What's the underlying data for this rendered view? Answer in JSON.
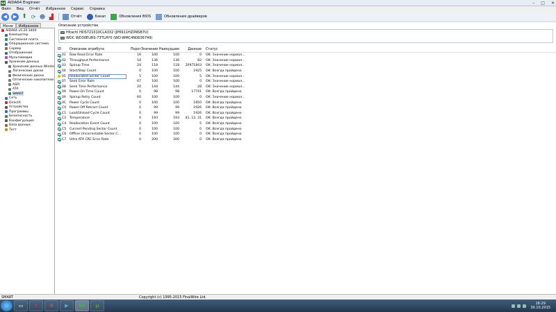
{
  "window": {
    "title": "AIDA64 Engineer",
    "controls": [
      "–",
      "□",
      "✕"
    ]
  },
  "menu": [
    "Файл",
    "Вид",
    "Отчёт",
    "Избранное",
    "Сервис",
    "Справка"
  ],
  "toolbar": {
    "report": "Отчёт",
    "bios_label": "Бэкап",
    "bios_update": "Обновления BIOS",
    "driver_update": "Обновления драйверов"
  },
  "left_tabs": [
    "Меню",
    "Избранное"
  ],
  "tree": [
    {
      "label": "AIDA64 v5.20.3400",
      "level": 0,
      "color": "#c03030"
    },
    {
      "label": "Компьютер",
      "level": 1,
      "color": "#3a6ba8"
    },
    {
      "label": "Системная плата",
      "level": 1,
      "color": "#2e8b57"
    },
    {
      "label": "Операционная система",
      "level": 1,
      "color": "#3a6ba8"
    },
    {
      "label": "Сервер",
      "level": 1,
      "color": "#8a6d3b"
    },
    {
      "label": "Отображение",
      "level": 1,
      "color": "#3a6ba8"
    },
    {
      "label": "Мультимедиа",
      "level": 1,
      "color": "#b0508a"
    },
    {
      "label": "Хранение данных",
      "level": 1,
      "color": "#555555"
    },
    {
      "label": "Хранение данных Windows",
      "level": 2,
      "color": "#777777"
    },
    {
      "label": "Логические диски",
      "level": 2,
      "color": "#777777"
    },
    {
      "label": "Физические диски",
      "level": 2,
      "color": "#777777"
    },
    {
      "label": "Оптические накопители",
      "level": 2,
      "color": "#777777"
    },
    {
      "label": "ASPI",
      "level": 2,
      "color": "#777777"
    },
    {
      "label": "ATA",
      "level": 2,
      "color": "#777777"
    },
    {
      "label": "SMART",
      "level": 2,
      "color": "#2e8b57",
      "selected": true
    },
    {
      "label": "Сеть",
      "level": 1,
      "color": "#3a6ba8"
    },
    {
      "label": "DirectX",
      "level": 1,
      "color": "#c03030"
    },
    {
      "label": "Устройства",
      "level": 1,
      "color": "#555555"
    },
    {
      "label": "Программы",
      "level": 1,
      "color": "#3a6ba8"
    },
    {
      "label": "Безопасность",
      "level": 1,
      "color": "#2e8b57"
    },
    {
      "label": "Конфигурация",
      "level": 1,
      "color": "#555555"
    },
    {
      "label": "База данных",
      "level": 1,
      "color": "#8a6d3b"
    },
    {
      "label": "Тест",
      "level": 1,
      "color": "#d08a20"
    }
  ],
  "device_section_title": "Описание устройства",
  "devices": [
    "Hitachi HDS721010CLA332 (JP6911HZ0NSB7U)",
    "WDC WD30EURS-73TLHY0 (WD-WMC4N0636749)"
  ],
  "smart_headers": {
    "id": "ID",
    "name": "Описание атрибута",
    "threshold": "Порог",
    "value": "Значение",
    "worst": "Наихудшее",
    "data": "Данные",
    "status": "Статус"
  },
  "smart_rows": [
    {
      "id": "01",
      "name": "Raw Read Error Rate",
      "threshold": "16",
      "value": "100",
      "worst": "100",
      "data": "0",
      "status": "OK: Значение нормал..."
    },
    {
      "id": "02",
      "name": "Throughput Performance",
      "threshold": "54",
      "value": "136",
      "worst": "136",
      "data": "82",
      "status": "OK: Значение нормал..."
    },
    {
      "id": "03",
      "name": "Spinup Time",
      "threshold": "24",
      "value": "118",
      "worst": "118",
      "data": "20971843",
      "status": "OK: Значение нормал..."
    },
    {
      "id": "04",
      "name": "Start/Stop Count",
      "threshold": "0",
      "value": "100",
      "worst": "100",
      "data": "1925",
      "status": "OK: Всегда пройдено"
    },
    {
      "id": "05",
      "name": "Reallocated Sector Count",
      "threshold": "5",
      "value": "100",
      "worst": "100",
      "data": "5",
      "status": "OK: Значение нормал...",
      "warn": true
    },
    {
      "id": "07",
      "name": "Seek Error Rate",
      "threshold": "67",
      "value": "100",
      "worst": "100",
      "data": "0",
      "status": "OK: Значение нормал..."
    },
    {
      "id": "08",
      "name": "Seek Time Performance",
      "threshold": "20",
      "value": "144",
      "worst": "144",
      "data": "28",
      "status": "OK: Значение нормал..."
    },
    {
      "id": "09",
      "name": "Power-On Time Count",
      "threshold": "0",
      "value": "98",
      "worst": "98",
      "data": "17741",
      "status": "OK: Всегда пройдено"
    },
    {
      "id": "0A",
      "name": "Spinup Retry Count",
      "threshold": "60",
      "value": "100",
      "worst": "100",
      "data": "0",
      "status": "OK: Значение нормал..."
    },
    {
      "id": "0C",
      "name": "Power Cycle Count",
      "threshold": "0",
      "value": "100",
      "worst": "100",
      "data": "1850",
      "status": "OK: Всегда пройдено"
    },
    {
      "id": "C0",
      "name": "Power-Off Retract Count",
      "threshold": "0",
      "value": "99",
      "worst": "99",
      "data": "1926",
      "status": "OK: Всегда пройдено"
    },
    {
      "id": "C1",
      "name": "Load/Unload Cycle Count",
      "threshold": "0",
      "value": "99",
      "worst": "99",
      "data": "1926",
      "status": "OK: Всегда пройдено"
    },
    {
      "id": "C2",
      "name": "Temperature",
      "threshold": "0",
      "value": "193",
      "worst": "193",
      "data": "41, 12, 31",
      "status": "OK: Всегда пройдено"
    },
    {
      "id": "C4",
      "name": "Reallocation Event Count",
      "threshold": "0",
      "value": "100",
      "worst": "100",
      "data": "5",
      "status": "OK: Всегда пройдено"
    },
    {
      "id": "C5",
      "name": "Current Pending Sector Count",
      "threshold": "0",
      "value": "100",
      "worst": "100",
      "data": "0",
      "status": "OK: Всегда пройдено"
    },
    {
      "id": "C6",
      "name": "Offline Uncorrectable Sector C...",
      "threshold": "0",
      "value": "100",
      "worst": "100",
      "data": "0",
      "status": "OK: Всегда пройдено"
    },
    {
      "id": "C7",
      "name": "Ultra ATA CRC Error Rate",
      "threshold": "0",
      "value": "200",
      "worst": "200",
      "data": "0",
      "status": "OK: Всегда пройдено"
    }
  ],
  "statusbar": {
    "left": "SMART",
    "copyright": "Copyright (c) 1995-2015 FinalWire Ltd."
  },
  "taskbar": {
    "time": "16:29",
    "date": "30.10.2015",
    "buttons": [
      "folder-icon",
      "yandex-browser-icon",
      "yandex-icon",
      "media-player-icon",
      "aida64-icon",
      "utorrent-icon"
    ]
  }
}
